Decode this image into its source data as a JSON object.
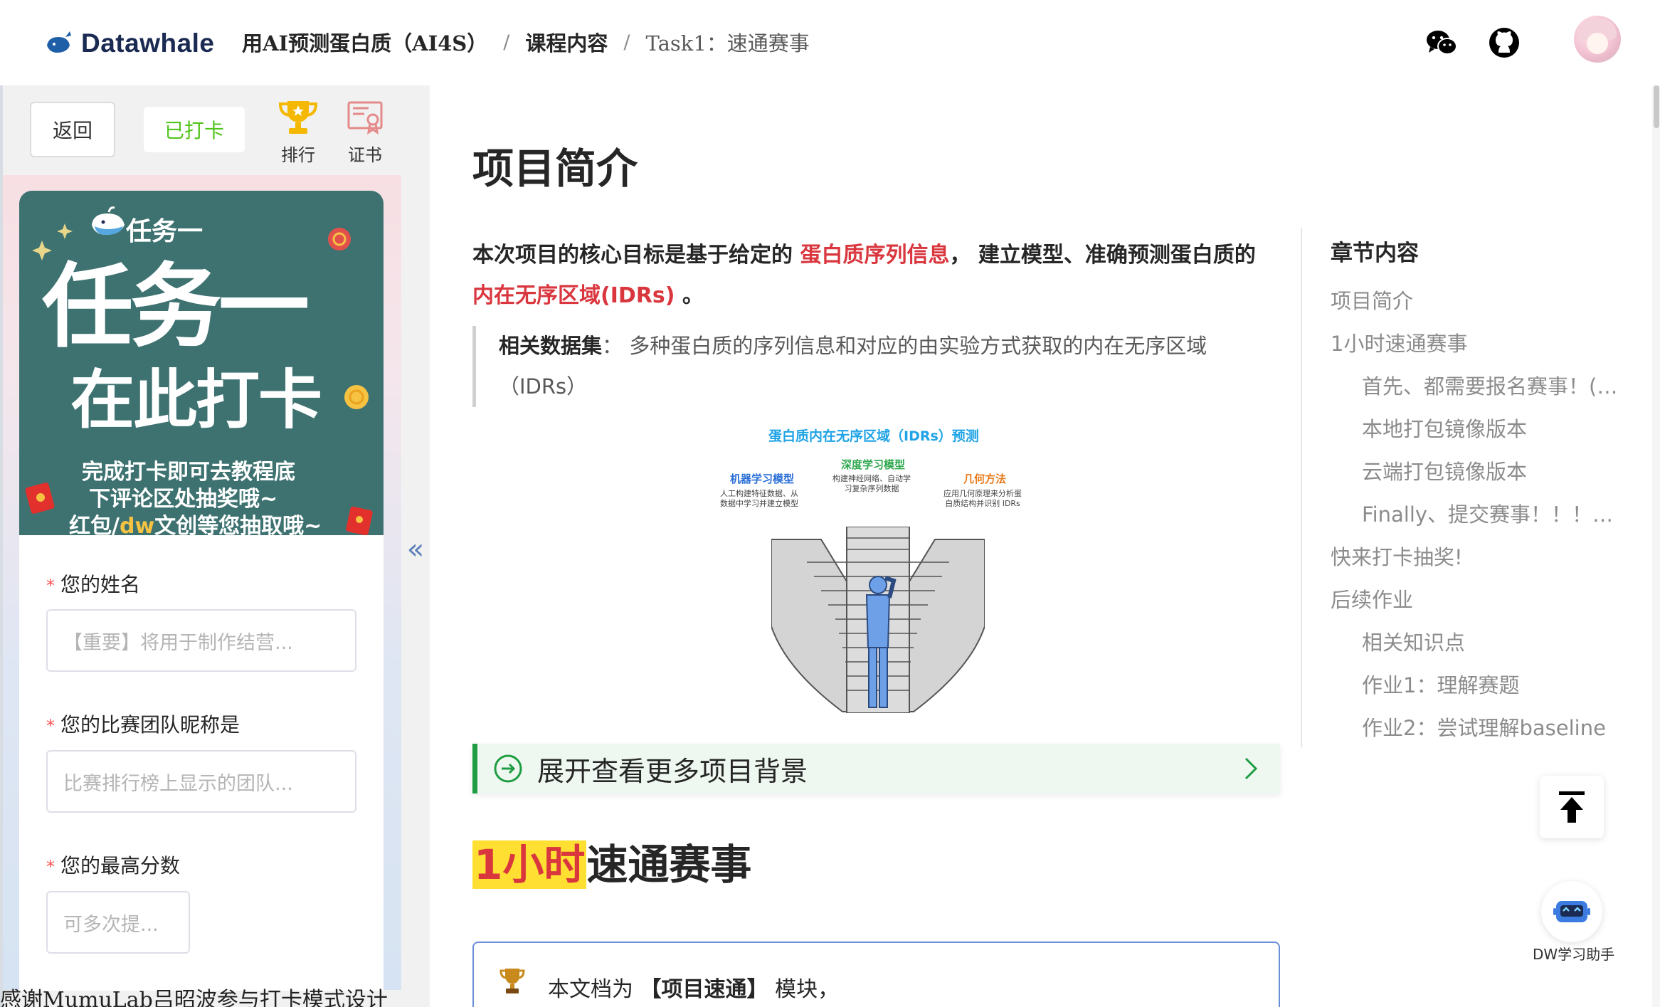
{
  "header": {
    "logo_text": "Datawhale",
    "breadcrumb": [
      "用AI预测蛋白质（AI4S）",
      "课程内容",
      "Task1：速通赛事"
    ],
    "icons": [
      "wechat-icon",
      "github-icon"
    ]
  },
  "sidebar": {
    "back_label": "返回",
    "checked_label": "已打卡",
    "rank_label": "排行",
    "certificate_label": "证书",
    "poster": {
      "task_label": "任务一",
      "big_text": "任务一",
      "mid_text": "在此打卡",
      "line1": "完成打卡即可去教程底",
      "line2": "下评论区处抽奖哦~",
      "line3_a": "红包/",
      "line3_b": "dw",
      "line3_c": "文创等您抽取哦~"
    },
    "form": {
      "name_label": "您的姓名",
      "name_placeholder": "【重要】将用于制作结营...",
      "team_label": "您的比赛团队昵称是",
      "team_placeholder": "比赛排行榜上显示的团队...",
      "score_label": "您的最高分数",
      "score_placeholder": "可多次提..."
    },
    "collapse_icon": "«",
    "thanks": "感谢MumuLab吕昭波参与打卡模式设计"
  },
  "main": {
    "h1": "项目简介",
    "intro_a": "本次项目的核心目标是基于给定的",
    "intro_hl1": "蛋白质序列信息",
    "intro_b": "， 建立模型、准确预测蛋白质的",
    "intro_hl2": "内在无序区域(IDRs)",
    "intro_c": "。",
    "quote_label": "相关数据集",
    "quote_text": "： 多种蛋白质的序列信息和对应的由实验方式获取的内在无序区域（IDRs）",
    "figure": {
      "title": "蛋白质内在无序区域（IDRs）预测",
      "col1_title": "机器学习模型",
      "col1_text": "人工构建特征数据、从\n数据中学习并建立模型",
      "col2_title": "深度学习模型",
      "col2_text": "构建神经网络、自动学\n习复杂序列数据",
      "col3_title": "几何方法",
      "col3_text": "应用几何原理来分析蛋\n白质结构并识别 IDRs"
    },
    "expand_label": "展开查看更多项目背景",
    "h2_mark": "1小时",
    "h2_rest": "速通赛事",
    "note_prefix": "本文档为",
    "note_bold": "【项目速通】",
    "note_suffix": "模块，"
  },
  "toc": {
    "title": "章节内容",
    "items": [
      {
        "label": "项目简介",
        "level": 1
      },
      {
        "label": "1小时速通赛事",
        "level": 1
      },
      {
        "label": "首先、都需要报名赛事！(…",
        "level": 2
      },
      {
        "label": "本地打包镜像版本",
        "level": 2
      },
      {
        "label": "云端打包镜像版本",
        "level": 2
      },
      {
        "label": "Finally、提交赛事！！！…",
        "level": 2
      },
      {
        "label": "快来打卡抽奖!",
        "level": 1
      },
      {
        "label": "后续作业",
        "level": 1
      },
      {
        "label": "相关知识点",
        "level": 2
      },
      {
        "label": "作业1：理解赛题",
        "level": 2
      },
      {
        "label": "作业2：尝试理解baseline",
        "level": 2
      }
    ]
  },
  "floating": {
    "assistant_label": "DW学习助手"
  },
  "colors": {
    "accent_red": "#d9363e",
    "check_green": "#52c41a",
    "expand_green": "#1f9d44",
    "poster_teal": "#3e7271",
    "highlight_yellow": "#ffe032"
  }
}
